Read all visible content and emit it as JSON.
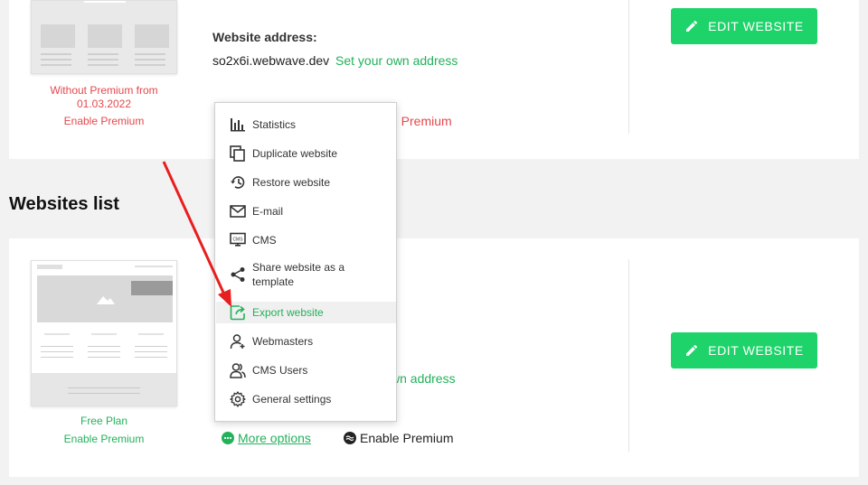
{
  "top_card": {
    "plan_status_line1": "Without Premium from",
    "plan_status_line2": "01.03.2022",
    "enable_premium": "Enable Premium",
    "address_label": "Website address:",
    "address_value": "so2x6i.webwave.dev",
    "address_link": "Set your own address",
    "premium_partial": "e Premium",
    "edit_button": "EDIT WEBSITE"
  },
  "section_title": "Websites list",
  "bottom_card": {
    "plan": "Free Plan",
    "enable_premium": "Enable Premium",
    "address_partial": "wn address",
    "edit_button": "EDIT WEBSITE",
    "more_options": "More options",
    "enable_premium_link": "Enable Premium"
  },
  "dropdown": {
    "items": [
      {
        "label": "Statistics",
        "icon": "bar-chart-icon"
      },
      {
        "label": "Duplicate website",
        "icon": "copy-icon"
      },
      {
        "label": "Restore website",
        "icon": "history-icon"
      },
      {
        "label": "E-mail",
        "icon": "mail-icon"
      },
      {
        "label": "CMS",
        "icon": "monitor-icon"
      },
      {
        "label": "Share website as a template",
        "icon": "share-icon"
      },
      {
        "label": "Export website",
        "icon": "export-icon"
      },
      {
        "label": "Webmasters",
        "icon": "user-add-icon"
      },
      {
        "label": "CMS Users",
        "icon": "users-icon"
      },
      {
        "label": "General settings",
        "icon": "gear-icon"
      }
    ]
  },
  "colors": {
    "accent_green": "#1ed36a",
    "link_green": "#23b15a",
    "warning_red": "#e5484d",
    "arrow_red": "#e81e1e"
  }
}
